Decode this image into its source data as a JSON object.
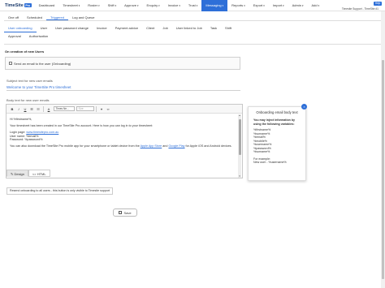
{
  "app": {
    "logo_text": "TimeSite",
    "logo_badge": "Pro"
  },
  "nav": {
    "items": [
      {
        "label": "Dashboard"
      },
      {
        "label": "Timesheet"
      },
      {
        "label": "Roster"
      },
      {
        "label": "Shift"
      },
      {
        "label": "Approve"
      },
      {
        "label": "Enquiry"
      },
      {
        "label": "Invoice"
      },
      {
        "label": "Trust"
      },
      {
        "label": "Messaging",
        "active": true
      },
      {
        "label": "Reports"
      },
      {
        "label": "Export"
      },
      {
        "label": "Import"
      },
      {
        "label": "Admin"
      },
      {
        "label": "Add"
      }
    ],
    "help_label": "Help",
    "user_line": "Timesite Support - TimeSite #1"
  },
  "tabs_primary": [
    {
      "label": "One off"
    },
    {
      "label": "Scheduled"
    },
    {
      "label": "Triggered",
      "active": true
    },
    {
      "label": "Log and Queue"
    }
  ],
  "tabs_secondary": [
    {
      "label": "User onboarding",
      "active": true
    },
    {
      "label": "User"
    },
    {
      "label": "User password change"
    },
    {
      "label": "Invoice"
    },
    {
      "label": "Payment advice"
    },
    {
      "label": "Client"
    },
    {
      "label": "Job"
    },
    {
      "label": "User linked to Job"
    },
    {
      "label": "Task"
    },
    {
      "label": "Shift"
    },
    {
      "label": "Approval"
    },
    {
      "label": "Authorisation"
    }
  ],
  "form": {
    "section_title": "On creation of new Users",
    "send_onboarding_label": "Send an email to the user (Onboarding)",
    "subject_label": "Subject text for new user emails",
    "subject_value": "Welcome to your TimeSite Pro timesheet",
    "body_label": "Body text for new user emails",
    "toolbar": {
      "bold": "B",
      "italic": "I",
      "underline": "U",
      "font_family": "Times Ne...",
      "font_size": "Size"
    },
    "body": {
      "greeting": "Hi %firstname%,",
      "p1": "Your timesheet has been created in our TimeSite Pro account. Here is how you can log in to your timesheet:",
      "login_page_label": "Login page: ",
      "login_page_link": "www.timesitepro.com.au",
      "username_line": "User name: %email%",
      "password_line": "Password: %password%",
      "p3_before": "You can also download the TimeSite Pro mobile app for your smartphone or tablet device from the ",
      "app_store_link": "Apple App Store",
      "p3_and": " and ",
      "google_play_link": "Google Play",
      "p3_after": " for Apple iOS and Android devices."
    },
    "mode_design": "Design",
    "mode_html": "HTML",
    "resend_label": "Resend onboarding to all users - this button is only visible to Timesite support",
    "save_label": "Save"
  },
  "info_panel": {
    "title": "Onboarding email body text",
    "intro": "You may inject information by using the following variables:",
    "variables": [
      "%firstname%",
      "%surname%",
      "%email%",
      "%mobile%",
      "%username%",
      "%password%",
      "%surname%"
    ],
    "example_label": "For example:",
    "example_value": "New user - %username%"
  },
  "colors": {
    "accent": "#2e6fd8",
    "brand_dark": "#1a3a6b"
  }
}
